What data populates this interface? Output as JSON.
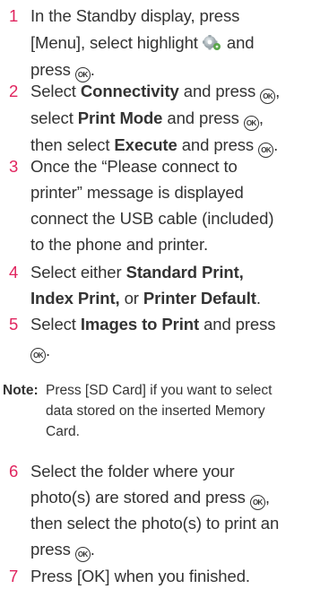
{
  "steps": [
    {
      "number": "1",
      "text": "In the Standby display, press [Menu], select highlight and press .",
      "parts": {
        "l1": "In the Standby display, press",
        "l2a": "[Menu], select highlight",
        "l2b": "and",
        "l3a": "press",
        "l3b": "."
      }
    },
    {
      "number": "2",
      "text": "Select Connectivity and press , select Print Mode and press , then select Execute and press .",
      "parts": {
        "l1a": "Select",
        "l1b": "Connectivity",
        "l1c": "and press",
        "l1d": ",",
        "l2a": "select",
        "l2b": "Print Mode",
        "l2c": "and press",
        "l2d": ",",
        "l3a": "then select",
        "l3b": "Execute",
        "l3c": "and press",
        "l3d": "."
      }
    },
    {
      "number": "3",
      "text": "Once the “Please connect to printer” message is displayed connect the USB cable (included) to the phone and printer.",
      "parts": {
        "l1": "Once the “Please connect to",
        "l2": "printer” message is displayed",
        "l3": "connect the USB cable (included)",
        "l4": "to the phone and printer."
      }
    },
    {
      "number": "4",
      "text": "Select either Standard Print, Index Print, or Printer Default.",
      "parts": {
        "l1a": "Select either",
        "l1b": "Standard Print,",
        "l2a": "Index Print,",
        "l2b": "or",
        "l2c": "Printer Default",
        "l2d": "."
      }
    },
    {
      "number": "5",
      "text": "Select Images to Print and press .",
      "parts": {
        "l1a": "Select",
        "l1b": "Images to Print",
        "l1c": "and press",
        "l2b": "."
      }
    },
    {
      "number": "6",
      "text": "Select the folder where your photo(s) are stored and press , then select the photo(s) to print an press .",
      "parts": {
        "l1": "Select the folder where your",
        "l2a": "photo(s) are stored and press",
        "l2b": ",",
        "l3": "then select the photo(s) to print an",
        "l4a": "press",
        "l4b": "."
      }
    },
    {
      "number": "7",
      "text": "Press [OK] when you finished.",
      "parts": {
        "l1": "Press [OK] when you finished."
      }
    }
  ],
  "note": {
    "label": "Note:",
    "l1": "Press [SD Card] if you want to select",
    "l2": "data stored on the inserted Memory",
    "l3": "Card."
  },
  "ok_glyph": "OK",
  "icons": {
    "settings": "settings-gear-icon",
    "ok_button": "ok-button-icon"
  },
  "colors": {
    "step_number": "#e0245e",
    "text": "#333333"
  }
}
